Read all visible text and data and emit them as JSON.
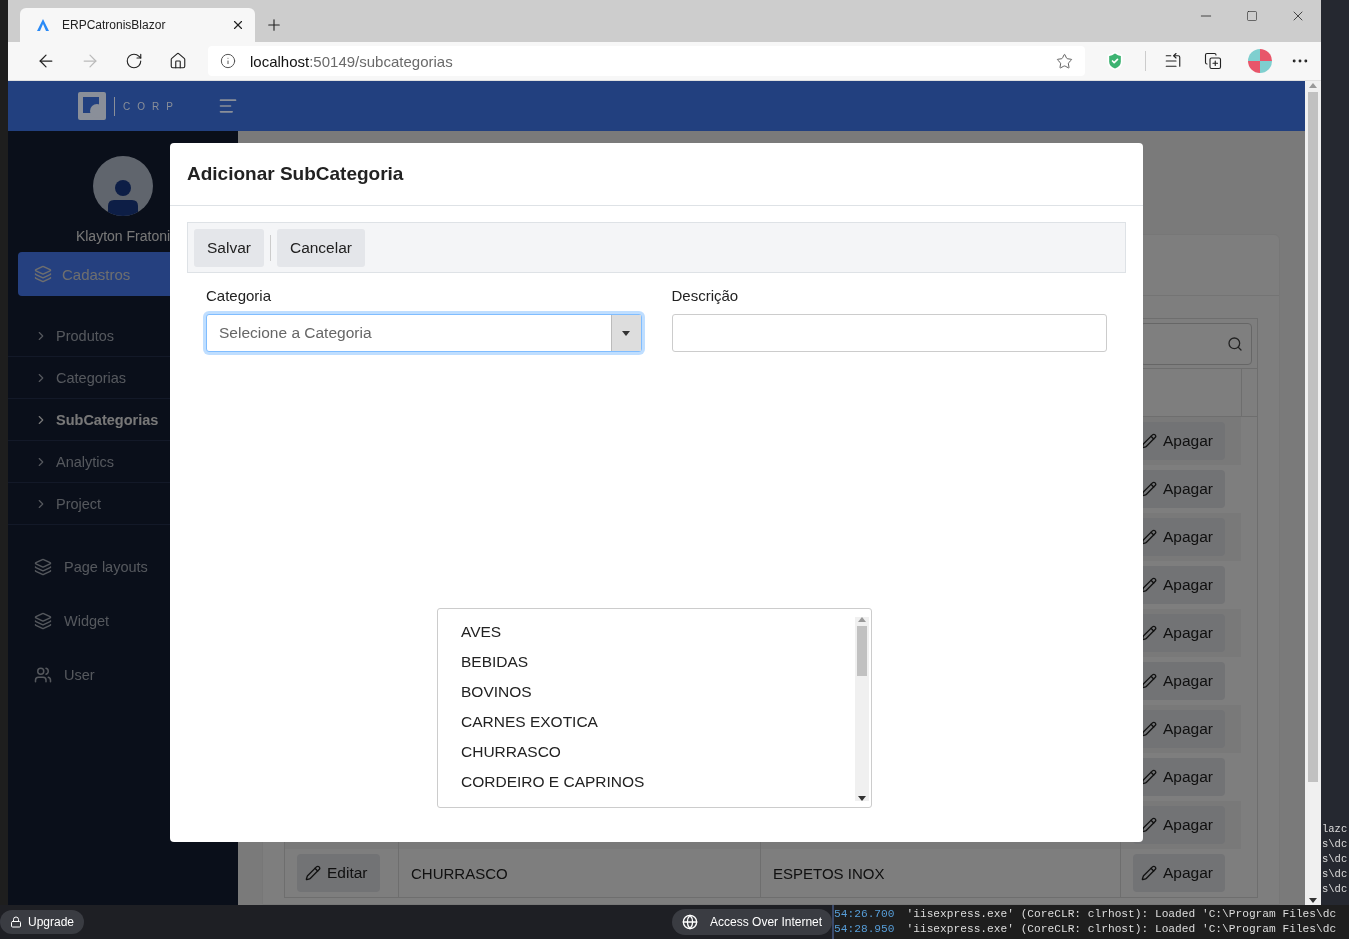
{
  "browser": {
    "tab_title": "ERPCatronisBlazor",
    "url_host": "localhost",
    "url_path": ":50149/subcategorias"
  },
  "header": {
    "brand": "CORP"
  },
  "sidebar": {
    "user_name": "Klayton Fratoni",
    "section": {
      "label": "Cadastros",
      "selected": true
    },
    "items": [
      {
        "label": "Produtos",
        "selected": false
      },
      {
        "label": "Categorias",
        "selected": false
      },
      {
        "label": "SubCategorias",
        "selected": true
      },
      {
        "label": "Analytics",
        "selected": false
      },
      {
        "label": "Project",
        "selected": false
      }
    ],
    "extra": [
      {
        "label": "Page layouts",
        "kind": "layers"
      },
      {
        "label": "Widget",
        "kind": "layers"
      },
      {
        "label": "User",
        "kind": "users"
      }
    ]
  },
  "table": {
    "rows": [
      {
        "delete": "Apagar"
      },
      {
        "delete": "Apagar"
      },
      {
        "delete": "Apagar"
      },
      {
        "delete": "Apagar"
      },
      {
        "delete": "Apagar"
      },
      {
        "delete": "Apagar"
      },
      {
        "delete": "Apagar"
      },
      {
        "delete": "Apagar"
      },
      {
        "delete": "Apagar"
      },
      {
        "edit": "Editar",
        "cells": [
          "CHURRASCO",
          "ESPETOS INOX"
        ],
        "delete": "Apagar"
      }
    ]
  },
  "modal": {
    "title": "Adicionar SubCategoria",
    "buttons": [
      "Salvar",
      "Cancelar"
    ],
    "fields": [
      {
        "label": "Categoria",
        "kind": "select",
        "placeholder": "Selecione a Categoria",
        "focused": true
      },
      {
        "label": "Descrição",
        "kind": "text",
        "focused": false
      }
    ],
    "options": [
      "AVES",
      "BEBIDAS",
      "BOVINOS",
      "CARNES EXOTICA",
      "CHURRASCO",
      "CORDEIRO E CAPRINOS"
    ]
  },
  "taskbar": {
    "upgrade": "Upgrade",
    "tunnel": "Access Over Internet"
  },
  "output": {
    "lines": [
      {
        "time": "54:26.700",
        "text": "'iisexpress.exe' (CoreCLR: clrhost): Loaded 'C:\\Program Files\\dc"
      },
      {
        "time": "54:28.950",
        "text": "'iisexpress.exe' (CoreCLR: clrhost): Loaded 'C:\\Program Files\\dc"
      }
    ],
    "side_fragments": [
      "lazc",
      "s\\dc",
      "s\\dc",
      "s\\dc",
      "s\\dc"
    ]
  }
}
